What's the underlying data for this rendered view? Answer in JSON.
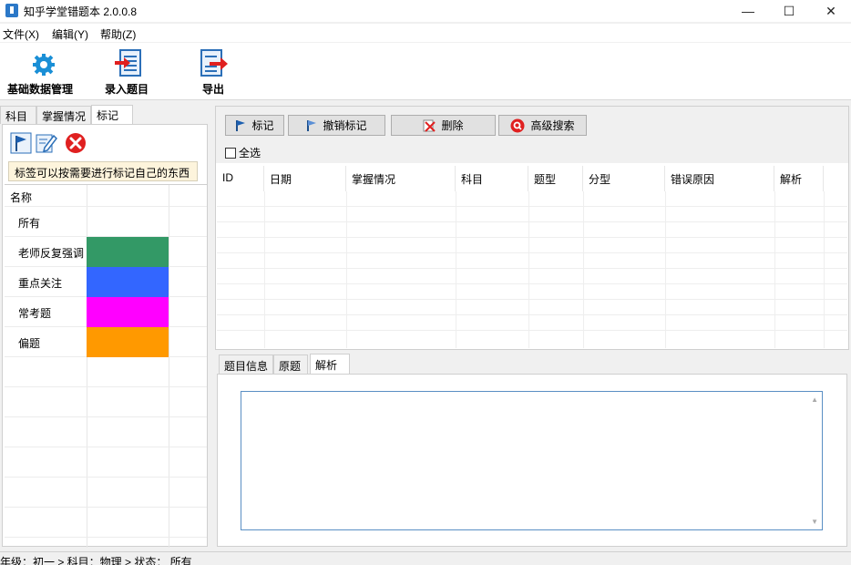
{
  "window": {
    "title": "知乎学堂错题本 2.0.0.8",
    "minimize": "—",
    "maximize": "☐",
    "close": "✕"
  },
  "menu": [
    "文件(X)",
    "编辑(Y)",
    "帮助(Z)"
  ],
  "toolbar": {
    "base_data": "基础数据管理",
    "enter_question": "录入题目",
    "export": "导出"
  },
  "left_tabs": [
    "科目",
    "掌握情况",
    "标记"
  ],
  "left": {
    "hint": "标签可以按需要进行标记自己的东西",
    "column_name": "名称",
    "tags": [
      {
        "name": "所有",
        "color": ""
      },
      {
        "name": "老师反复强调",
        "color": "#339966"
      },
      {
        "name": "重点关注",
        "color": "#3366ff"
      },
      {
        "name": "常考题",
        "color": "#ff00ff"
      },
      {
        "name": "偏题",
        "color": "#ff9900"
      }
    ]
  },
  "right_toolbar": {
    "mark": "标记",
    "unmark": "撤销标记",
    "delete": "删除",
    "advanced_search": "高级搜索",
    "select_all": "全选"
  },
  "table": {
    "columns": [
      "ID",
      "日期",
      "掌握情况",
      "科目",
      "题型",
      "分型",
      "错误原因",
      "解析"
    ]
  },
  "bottom_tabs": [
    "题目信息",
    "原题",
    "解析"
  ],
  "status": "年级：初一 > 科目：物理 > 状态：  所有",
  "colors": {
    "accent_blue": "#2b78c8",
    "delete_red": "#e02020",
    "box_border": "#5a8fc4"
  }
}
